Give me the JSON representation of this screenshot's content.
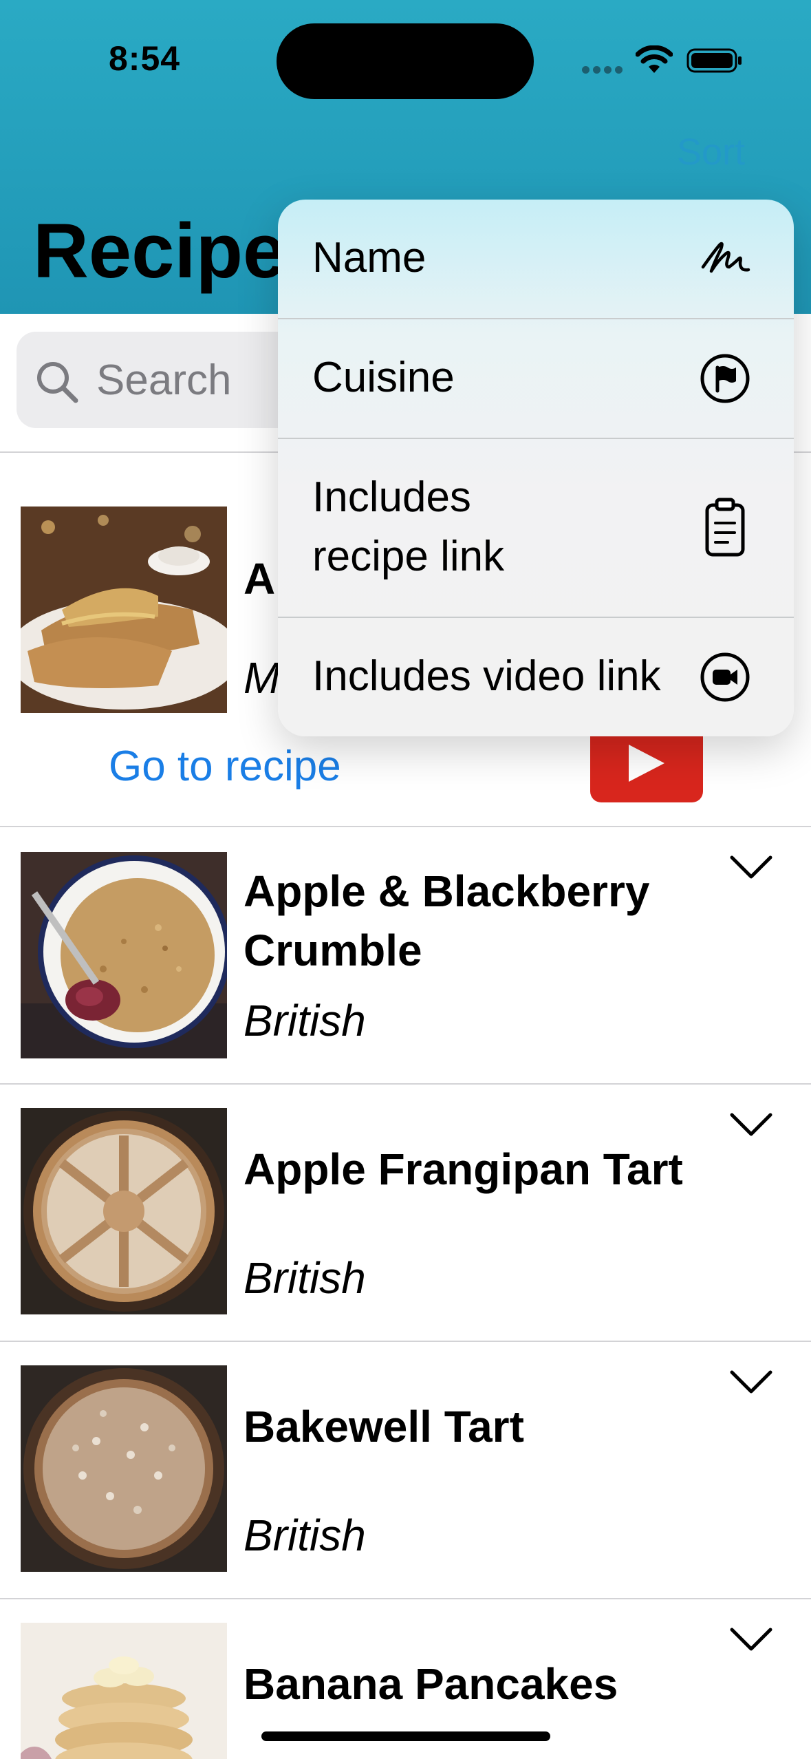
{
  "status_bar": {
    "time": "8:54"
  },
  "nav": {
    "sort_label": "Sort",
    "title": "Recipes"
  },
  "search": {
    "placeholder": "Search"
  },
  "expanded": {
    "name": "Ap",
    "cuisine": "M",
    "go_to_recipe": "Go to recipe"
  },
  "recipes": [
    {
      "name": "Apple & Blackberry Crumble",
      "cuisine": "British"
    },
    {
      "name": "Apple Frangipan Tart",
      "cuisine": "British"
    },
    {
      "name": "Bakewell Tart",
      "cuisine": "British"
    },
    {
      "name": "Banana Pancakes",
      "cuisine": ""
    }
  ],
  "sort_menu": {
    "items": [
      {
        "label": "Name",
        "icon": "signature-icon"
      },
      {
        "label": "Cuisine",
        "icon": "flag-circle-icon"
      },
      {
        "label": "Includes recipe link",
        "icon": "clipboard-icon"
      },
      {
        "label": "Includes video link",
        "icon": "video-circle-icon"
      }
    ]
  },
  "colors": {
    "header": "#2aaac4",
    "accent_link": "#1a7ee6",
    "video_red": "#d8261d"
  }
}
